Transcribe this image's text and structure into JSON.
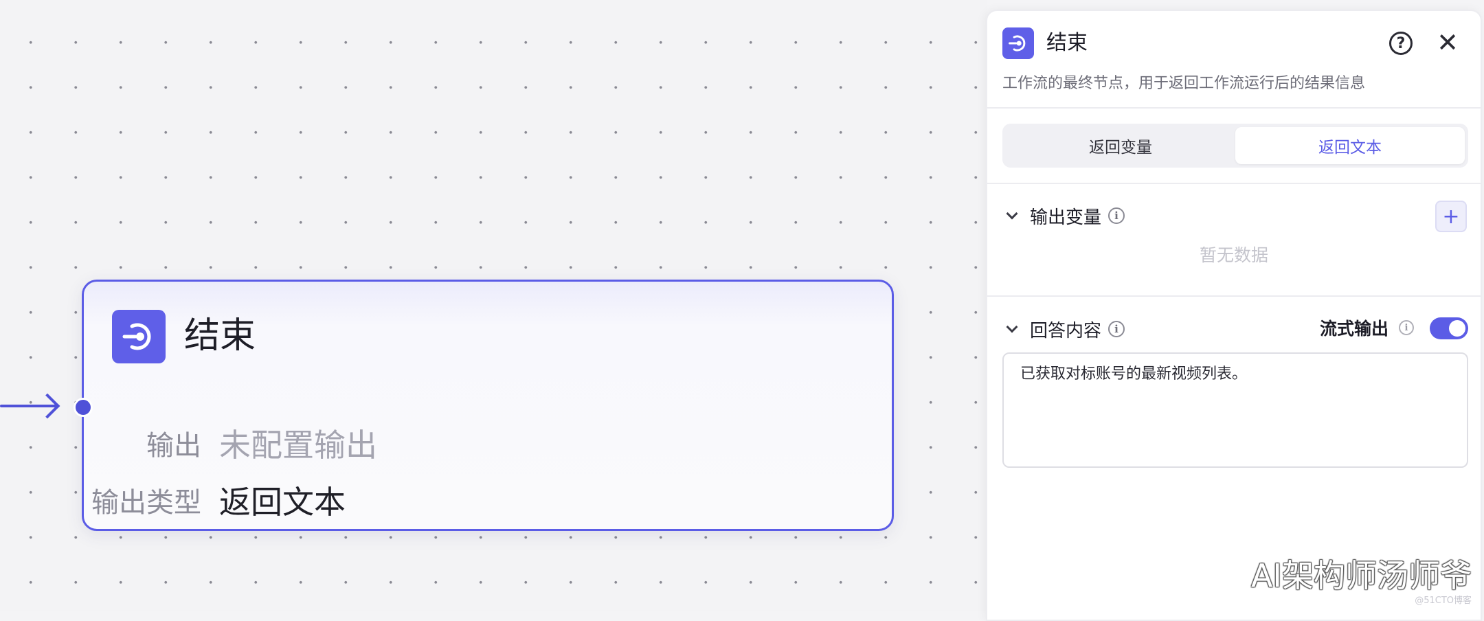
{
  "canvas": {
    "node": {
      "title": "结束",
      "icon": "end-node-icon",
      "rows": [
        {
          "label": "输出",
          "value": "未配置输出"
        },
        {
          "label": "输出类型",
          "value": "返回文本"
        }
      ]
    }
  },
  "panel": {
    "title": "结束",
    "icon": "end-node-icon",
    "description": "工作流的最终节点，用于返回工作流运行后的结果信息",
    "help_icon": "?",
    "close_icon": "✕",
    "tabs": [
      {
        "label": "返回变量",
        "active": false
      },
      {
        "label": "返回文本",
        "active": true
      }
    ],
    "output_section": {
      "title": "输出变量",
      "add_label": "+",
      "empty_text": "暂无数据"
    },
    "answer_section": {
      "title": "回答内容",
      "stream_label": "流式输出",
      "stream_enabled": true,
      "content": "已获取对标账号的最新视频列表。"
    }
  },
  "watermark": {
    "text": "AI架构师汤师爷",
    "sub": "@51CTO博客"
  },
  "colors": {
    "accent": "#5b5ce6",
    "icon_bg": "#5f5fe8"
  }
}
